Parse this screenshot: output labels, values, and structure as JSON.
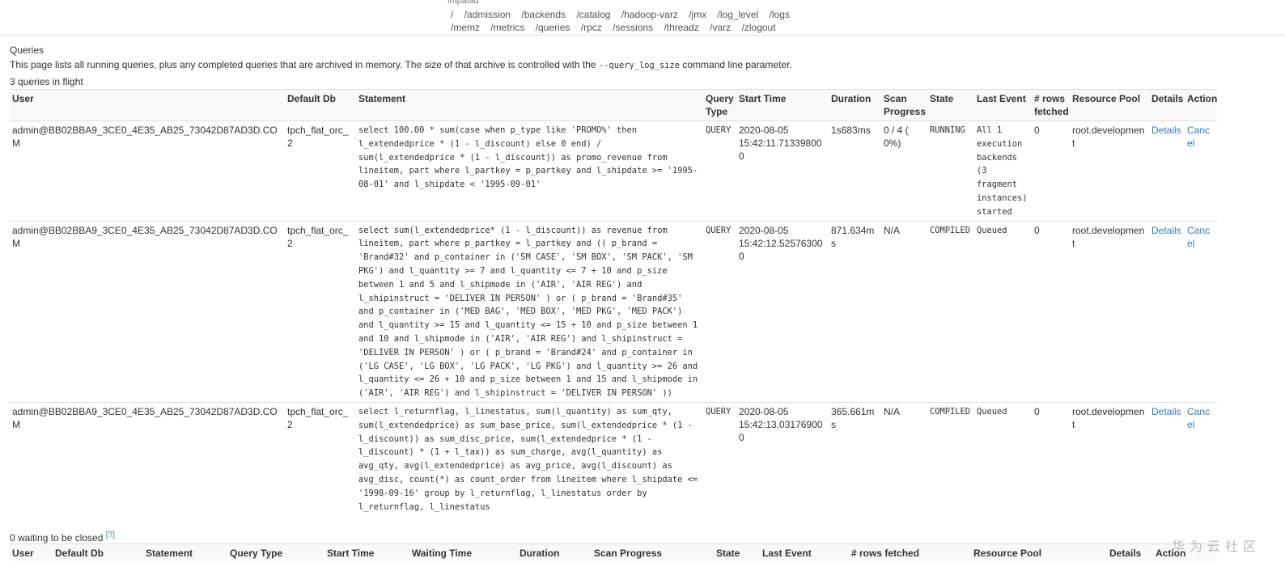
{
  "nav": {
    "brand": "impalad",
    "row1": [
      "/",
      "/admission",
      "/backends",
      "/catalog",
      "/hadoop-varz",
      "/jmx",
      "/log_level",
      "/logs"
    ],
    "row2": [
      "/memz",
      "/metrics",
      "/queries",
      "/rpcz",
      "/sessions",
      "/threadz",
      "/varz",
      "/zlogout"
    ]
  },
  "page": {
    "title": "Queries",
    "desc_pre": "This page lists all running queries, plus any completed queries that are archived in memory. The size of that archive is controlled with the ",
    "desc_code": "--query_log_size",
    "desc_post": " command line parameter.",
    "in_flight": "3 queries in flight",
    "waiting": "0 waiting to be closed",
    "help": "[?]"
  },
  "running_headers": {
    "user": "User",
    "default_db": "Default Db",
    "statement": "Statement",
    "query_type": "Query Type",
    "start_time": "Start Time",
    "duration": "Duration",
    "scan_progress": "Scan Progress",
    "state": "State",
    "last_event": "Last Event",
    "rows_fetched": "# rows fetched",
    "resource_pool": "Resource Pool",
    "details": "Details",
    "action": "Action"
  },
  "queries": [
    {
      "user": "admin@BB02BBA9_3CE0_4E35_AB25_73042D87AD3D.COM",
      "db": "tpch_flat_orc_2",
      "statement": "select 100.00 * sum(case when p_type like 'PROMO%' then l_extendedprice * (1 - l_discount) else 0 end) / sum(l_extendedprice * (1 - l_discount)) as promo_revenue from lineitem, part where l_partkey = p_partkey and l_shipdate >= '1995-08-01' and l_shipdate < '1995-09-01'",
      "type": "QUERY",
      "start": "2020-08-05 15:42:11.713398000",
      "duration": "1s683ms",
      "progress": "0 / 4 ( 0%)",
      "state": "RUNNING",
      "last_event": "All 1 execution backends (3 fragment instances) started",
      "rows": "0",
      "pool": "root.development",
      "details": "Details",
      "action": "Cancel"
    },
    {
      "user": "admin@BB02BBA9_3CE0_4E35_AB25_73042D87AD3D.COM",
      "db": "tpch_flat_orc_2",
      "statement": "select sum(l_extendedprice* (1 - l_discount)) as revenue from lineitem, part where p_partkey = l_partkey and (( p_brand = 'Brand#32' and p_container in ('SM CASE', 'SM BOX', 'SM PACK', 'SM PKG') and l_quantity >= 7 and l_quantity <= 7 + 10 and p_size between 1 and 5 and l_shipmode in ('AIR', 'AIR REG') and l_shipinstruct = 'DELIVER IN PERSON' ) or ( p_brand = 'Brand#35' and p_container in ('MED BAG', 'MED BOX', 'MED PKG', 'MED PACK') and l_quantity >= 15 and l_quantity <= 15 + 10 and p_size between 1 and 10 and l_shipmode in ('AIR', 'AIR REG') and l_shipinstruct = 'DELIVER IN PERSON' ) or ( p_brand = 'Brand#24' and p_container in ('LG CASE', 'LG BOX', 'LG PACK', 'LG PKG') and l_quantity >= 26 and l_quantity <= 26 + 10 and p_size between 1 and 15 and l_shipmode in ('AIR', 'AIR REG') and l_shipinstruct = 'DELIVER IN PERSON' ))",
      "type": "QUERY",
      "start": "2020-08-05 15:42:12.525763000",
      "duration": "871.634ms",
      "progress": "N/A",
      "state": "COMPILED",
      "last_event": "Queued",
      "rows": "0",
      "pool": "root.development",
      "details": "Details",
      "action": "Cancel"
    },
    {
      "user": "admin@BB02BBA9_3CE0_4E35_AB25_73042D87AD3D.COM",
      "db": "tpch_flat_orc_2",
      "statement": "select l_returnflag, l_linestatus, sum(l_quantity) as sum_qty, sum(l_extendedprice) as sum_base_price, sum(l_extendedprice * (1 - l_discount)) as sum_disc_price, sum(l_extendedprice * (1 - l_discount) * (1 + l_tax)) as sum_charge, avg(l_quantity) as avg_qty, avg(l_extendedprice) as avg_price, avg(l_discount) as avg_disc, count(*) as count_order from lineitem where l_shipdate <= '1998-09-16' group by l_returnflag, l_linestatus order by l_returnflag, l_linestatus",
      "type": "QUERY",
      "start": "2020-08-05 15:42:13.031769000",
      "duration": "365.661ms",
      "progress": "N/A",
      "state": "COMPILED",
      "last_event": "Queued",
      "rows": "0",
      "pool": "root.development",
      "details": "Details",
      "action": "Cancel"
    }
  ],
  "waiting_headers": [
    "User",
    "Default Db",
    "Statement",
    "Query Type",
    "Start Time",
    "Waiting Time",
    "Duration",
    "Scan Progress",
    "State",
    "Last Event",
    "# rows fetched",
    "Resource Pool",
    "Details",
    "Action"
  ],
  "watermark": "华为云社区"
}
